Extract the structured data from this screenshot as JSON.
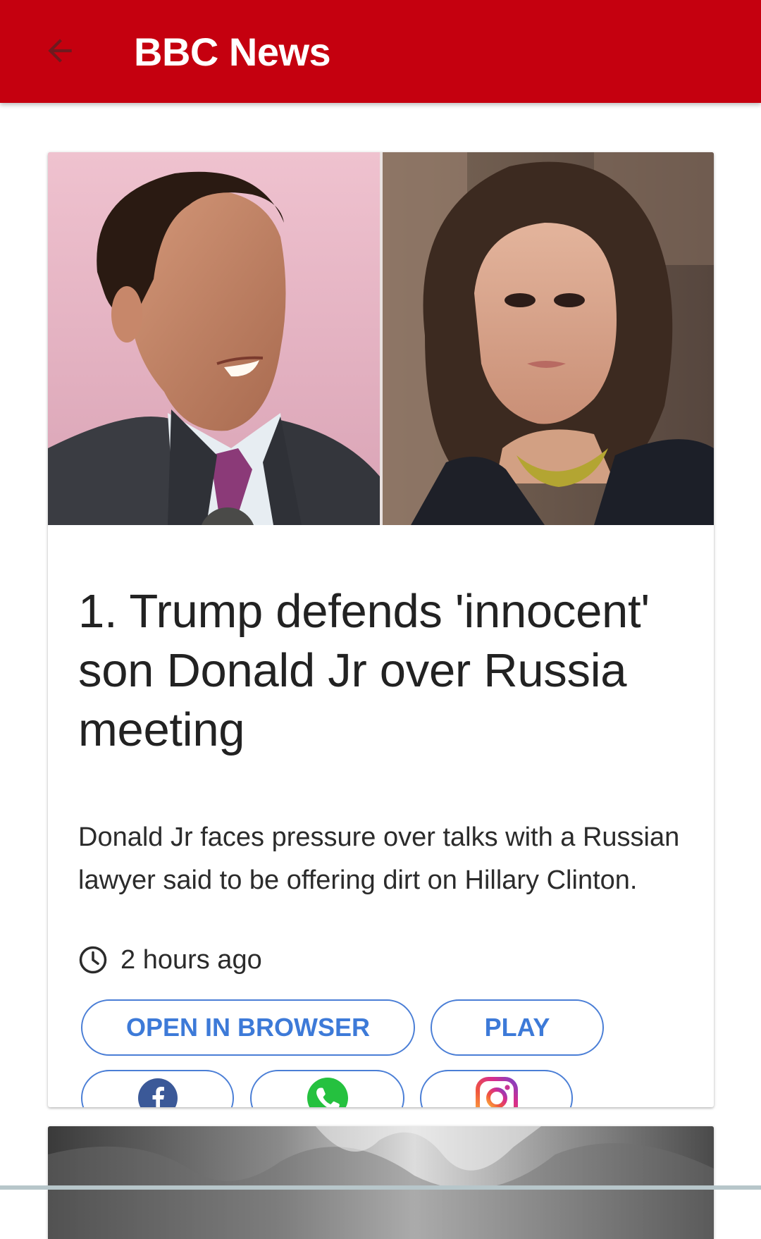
{
  "app_bar": {
    "back_icon": "arrow-left-icon",
    "title": "BBC News",
    "background": "#c5000f"
  },
  "article": {
    "image_description_icons": [
      "hero-photo-left",
      "hero-photo-right"
    ],
    "headline": "1. Trump defends 'innocent' son Donald Jr over Russia meeting",
    "summary": "Donald Jr faces pressure over talks with a Russian lawyer said to be offering dirt on Hillary Clinton.",
    "time_icon": "clock-icon",
    "timestamp": "2 hours ago",
    "actions": {
      "open_in_browser": "OPEN IN BROWSER",
      "play": "PLAY"
    },
    "share": {
      "facebook_icon": "facebook-icon",
      "whatsapp_icon": "whatsapp-icon",
      "instagram_icon": "instagram-icon"
    },
    "accent_color": "#3d7ad8"
  }
}
